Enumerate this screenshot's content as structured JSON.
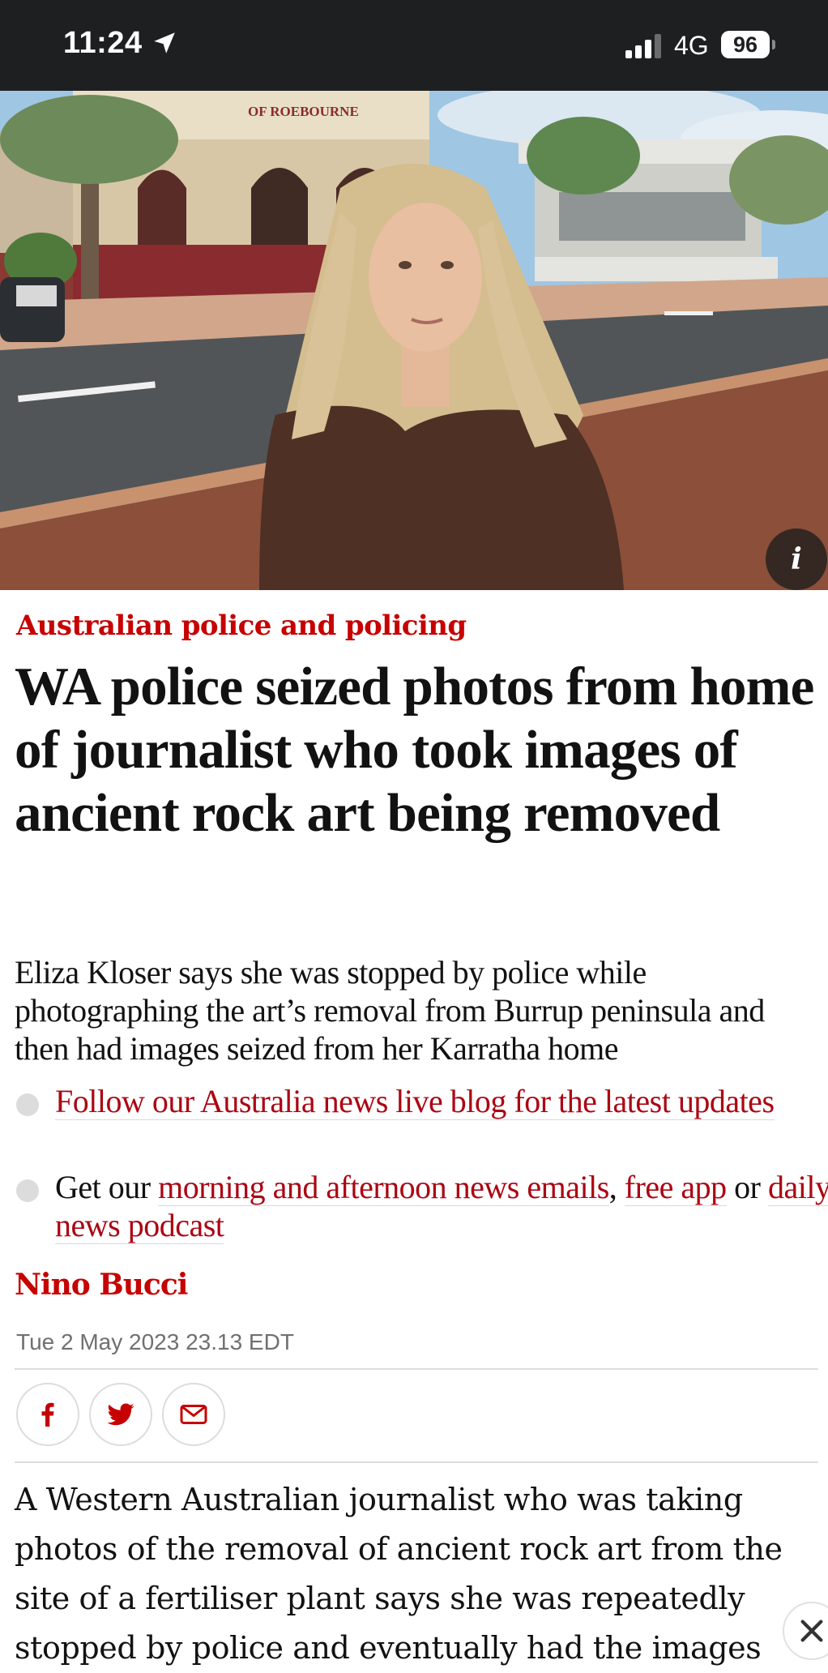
{
  "status_bar": {
    "time": "11:24",
    "location_icon": "location-arrow-icon",
    "signal_icon": "cellular-signal-icon",
    "network": "4G",
    "battery": "96"
  },
  "hero": {
    "sign_text": "OF ROEBOURNE",
    "info_label": "i"
  },
  "article": {
    "kicker": "Australian police and policing",
    "headline": "WA police seized photos from home of journalist who took images of ancient rock art being removed",
    "standfirst": "Eliza Kloser says she was stopped by police while photographing the art’s removal from Burrup peninsula and then had images seized from her Karratha home",
    "bullets": [
      {
        "link": "Follow our Australia news live blog for the latest updates"
      },
      {
        "prefix": "Get our ",
        "link1": "morning and afternoon news emails",
        "sep": ", ",
        "link2": "free app",
        "or": " or ",
        "link3": "daily news podcast"
      }
    ],
    "byline": "Nino Bucci",
    "date": "Tue 2 May 2023 23.13 EDT",
    "share": {
      "facebook_icon": "facebook-icon",
      "twitter_icon": "twitter-icon",
      "email_icon": "email-icon"
    },
    "body": "A Western Australian journalist who was taking photos of the removal of ancient rock art from the site of a fertiliser plant says she was repeatedly stopped by police and eventually had the images"
  },
  "colors": {
    "kicker_red": "#c70000",
    "link_red": "#ab0613",
    "status_bar_bg": "#1e1f21",
    "text": "#121212"
  }
}
